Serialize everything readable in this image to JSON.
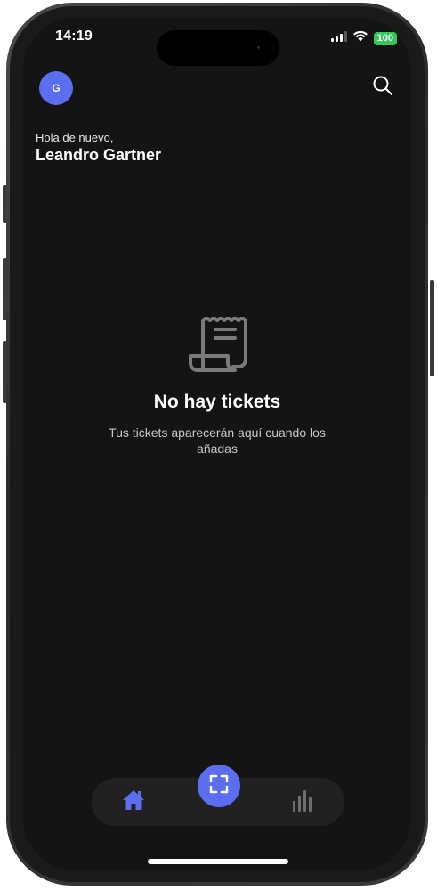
{
  "status_bar": {
    "time": "14:19",
    "battery": "100",
    "icons": [
      "signal-icon",
      "wifi-icon",
      "battery-icon"
    ]
  },
  "header": {
    "avatar_initial": "G",
    "greeting": "Hola de nuevo,",
    "user_name": "Leandro Gartner",
    "search_icon": "search-icon"
  },
  "empty_state": {
    "icon": "receipt-icon",
    "title": "No hay tickets",
    "subtitle": "Tus tickets aparecerán aquí cuando los añadas"
  },
  "tab_bar": {
    "items": [
      {
        "icon": "home-icon",
        "active": true
      },
      {
        "icon": "scan-icon",
        "active": false
      },
      {
        "icon": "stats-icon",
        "active": false
      }
    ]
  },
  "colors": {
    "accent": "#5b6ef0",
    "background": "#141414",
    "tab_bar_bg": "#212121",
    "battery_green": "#35c75a"
  }
}
